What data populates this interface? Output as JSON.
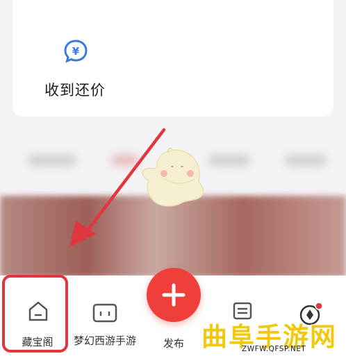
{
  "card": {
    "label": "收到还价",
    "icon": "yen-chat-bubble-icon",
    "icon_symbol": "¥",
    "icon_color": "#3a7be0"
  },
  "tabbar": {
    "items": [
      {
        "label": "藏宝阁",
        "icon": "home-icon",
        "highlighted": true
      },
      {
        "label": "梦幻西游手游",
        "icon": "game-icon"
      },
      {
        "label": "发布",
        "icon": "plus-icon"
      },
      {
        "label": "",
        "icon": "message-icon"
      },
      {
        "label": "",
        "icon": "mine-icon"
      }
    ]
  },
  "annotation": {
    "color": "#e0363f"
  },
  "watermark": {
    "name": "曲阜手游网",
    "url": "ZWFW.QFSP.NET",
    "color": "#f2c80f"
  }
}
